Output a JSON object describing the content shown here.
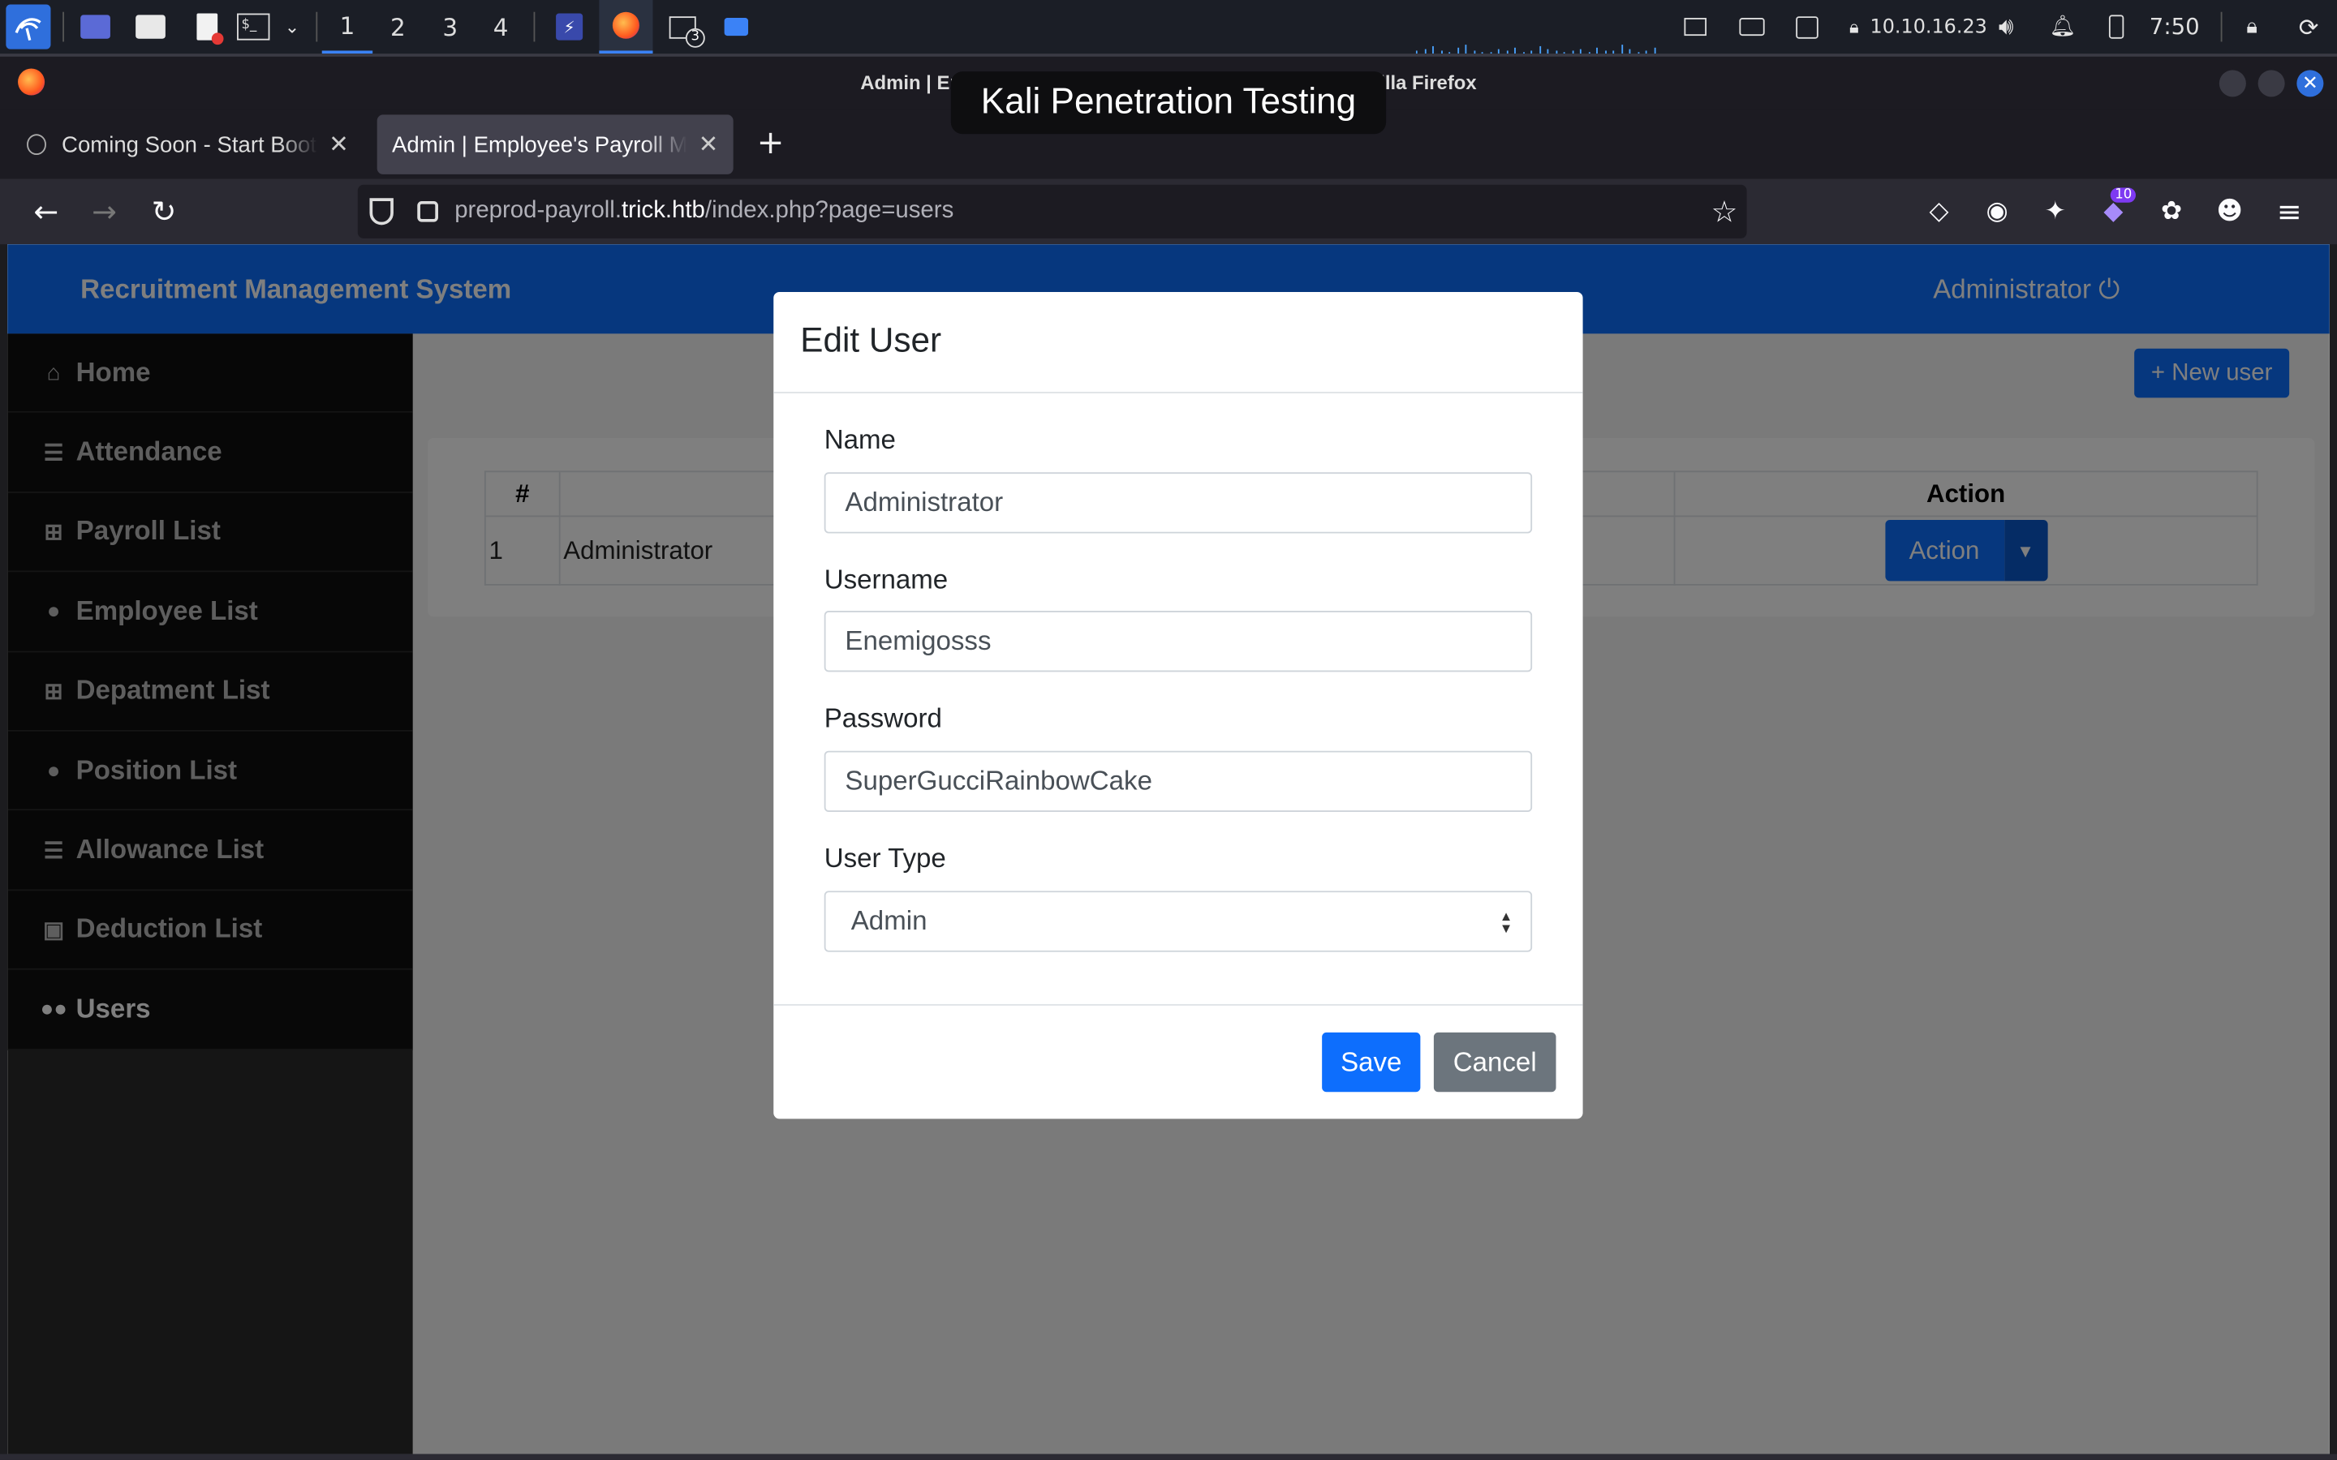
{
  "taskbar": {
    "workspaces": [
      "1",
      "2",
      "3",
      "4"
    ],
    "active_workspace": "1",
    "terminal_badge": "3",
    "ip_address": "10.10.16.23",
    "clock": "7:50",
    "icons": [
      "kali-menu-icon",
      "desktop-icon",
      "file-manager-icon",
      "text-editor-icon",
      "terminal-icon",
      "burp-icon",
      "firefox-icon",
      "terminal-window-icon",
      "folder-icon",
      "display-icon",
      "keyboard-icon",
      "network-icon",
      "vpn-icon",
      "volume-icon",
      "bell-icon",
      "battery-icon",
      "lock-icon",
      "restart-icon"
    ]
  },
  "window": {
    "title": "Admin | Employee's Payroll Management System — Mozilla Firefox",
    "overlay": "Kali Penetration Testing"
  },
  "tabs": [
    {
      "label": "Coming Soon - Start Bootstrap Theme",
      "active": false
    },
    {
      "label": "Admin | Employee's Payroll Management System",
      "active": true
    }
  ],
  "urlbar": {
    "prefix": "preprod-payroll.",
    "host": "trick.htb",
    "path": "/index.php?page=users"
  },
  "toolbar": {
    "extension_badge": "10"
  },
  "app": {
    "brand": "Recruitment Management System",
    "user": "Administrator",
    "new_user_label": "+ New user",
    "sidebar": [
      {
        "label": "Home",
        "icon": "home-icon"
      },
      {
        "label": "Attendance",
        "icon": "list-icon"
      },
      {
        "label": "Payroll List",
        "icon": "table-icon"
      },
      {
        "label": "Employee List",
        "icon": "user-icon"
      },
      {
        "label": "Depatment List",
        "icon": "table-icon"
      },
      {
        "label": "Position List",
        "icon": "user-icon"
      },
      {
        "label": "Allowance List",
        "icon": "list-icon"
      },
      {
        "label": "Deduction List",
        "icon": "money-icon"
      },
      {
        "label": "Users",
        "icon": "users-icon",
        "active": true
      }
    ],
    "table": {
      "headers": [
        "#",
        "",
        "",
        "Action"
      ],
      "rows": [
        {
          "num": "1",
          "name": "Administrator",
          "action": "Action"
        }
      ]
    }
  },
  "modal": {
    "title": "Edit User",
    "name_label": "Name",
    "name_value": "Administrator",
    "username_label": "Username",
    "username_value": "Enemigosss",
    "password_label": "Password",
    "password_value": "SuperGucciRainbowCake",
    "usertype_label": "User Type",
    "usertype_value": "Admin",
    "save_label": "Save",
    "cancel_label": "Cancel"
  }
}
